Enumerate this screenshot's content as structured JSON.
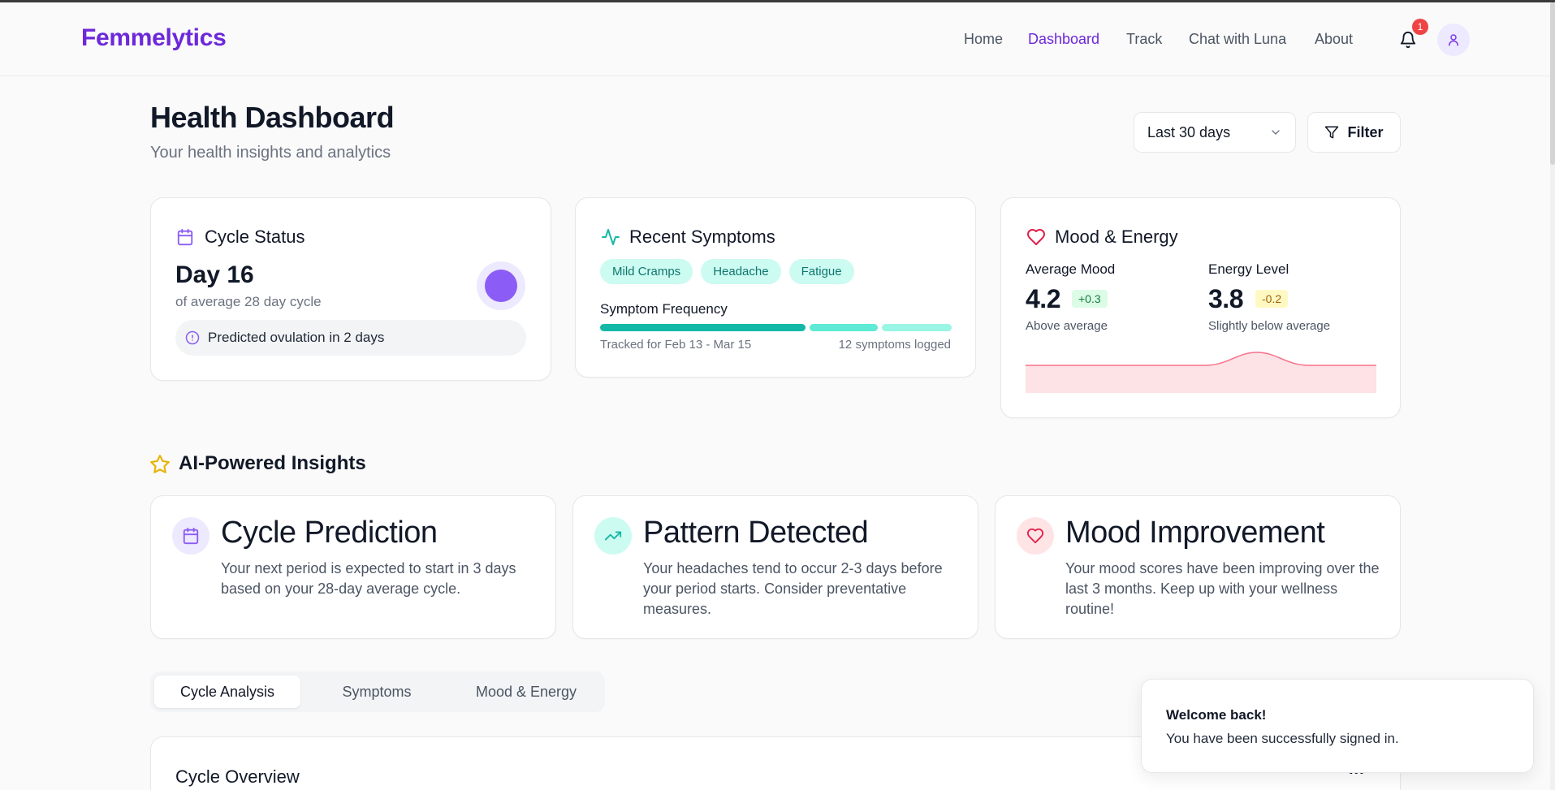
{
  "brand": "Femmelytics",
  "nav": {
    "home": "Home",
    "dashboard": "Dashboard",
    "track": "Track",
    "chat": "Chat with Luna",
    "about": "About"
  },
  "notifications": {
    "count": "1"
  },
  "header": {
    "title": "Health Dashboard",
    "subtitle": "Your health insights and analytics",
    "range": "Last 30 days",
    "filter": "Filter"
  },
  "cycle": {
    "title": "Cycle Status",
    "day": "Day 16",
    "sub": "of average 28 day cycle",
    "ovulation": "Predicted ovulation in 2 days",
    "color": "#8b5cf6"
  },
  "symptoms": {
    "title": "Recent Symptoms",
    "chips": [
      "Mild Cramps",
      "Headache",
      "Fatigue"
    ],
    "frequency_label": "Symptom Frequency",
    "tracked": "Tracked for Feb 13 - Mar 15",
    "logged": "12 symptoms logged",
    "colors": [
      "#14b8a6",
      "#5eead4",
      "#99f6e4"
    ]
  },
  "mood": {
    "title": "Mood & Energy",
    "avg_label": "Average Mood",
    "avg_value": "4.2",
    "avg_delta": "+0.3",
    "avg_note": "Above average",
    "energy_label": "Energy Level",
    "energy_value": "3.8",
    "energy_delta": "-0.2",
    "energy_note": "Slightly below average"
  },
  "insights": {
    "title": "AI-Powered Insights",
    "items": [
      {
        "title": "Cycle Prediction",
        "text": "Your next period is expected to start in 3 days based on your 28-day average cycle.",
        "icon": "calendar-icon"
      },
      {
        "title": "Pattern Detected",
        "text": "Your headaches tend to occur 2-3 days before your period starts. Consider preventative measures.",
        "icon": "trending-up-icon"
      },
      {
        "title": "Mood Improvement",
        "text": "Your mood scores have been improving over the last 3 months. Keep up with your wellness routine!",
        "icon": "heart-icon"
      }
    ]
  },
  "tabs": [
    "Cycle Analysis",
    "Symptoms",
    "Mood & Energy"
  ],
  "overview": {
    "title": "Cycle Overview",
    "more": "..."
  },
  "toast": {
    "title": "Welcome back!",
    "message": "You have been successfully signed in."
  }
}
